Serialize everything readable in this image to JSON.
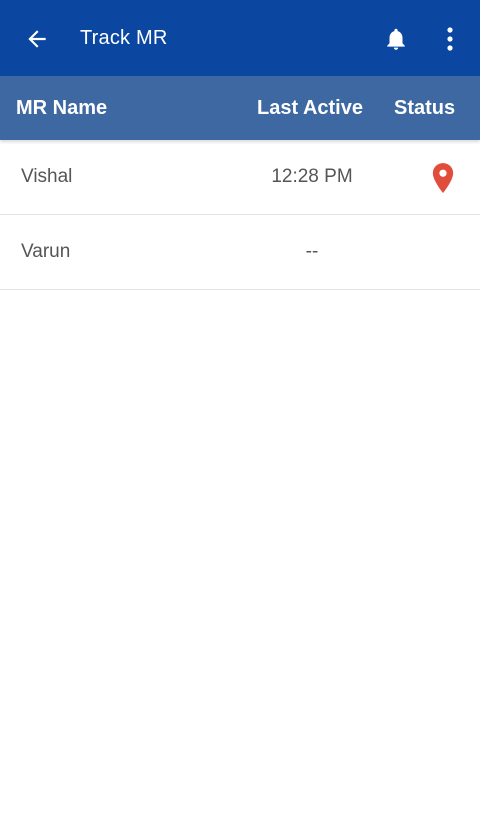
{
  "toolbar": {
    "title": "Track MR",
    "back_icon": "arrow-left-icon",
    "notification_icon": "bell-icon",
    "overflow_icon": "more-vert-icon"
  },
  "table": {
    "headers": {
      "name": "MR Name",
      "last_active": "Last Active",
      "status": "Status"
    },
    "rows": [
      {
        "name": "Vishal",
        "last_active": "12:28 PM",
        "status_icon": "location-pin-icon"
      },
      {
        "name": "Varun",
        "last_active": "--",
        "status_icon": ""
      }
    ]
  },
  "colors": {
    "toolbar": "#0b47a1",
    "header": "#3d68a1",
    "pin": "#e24c3b",
    "text": "#555555"
  }
}
